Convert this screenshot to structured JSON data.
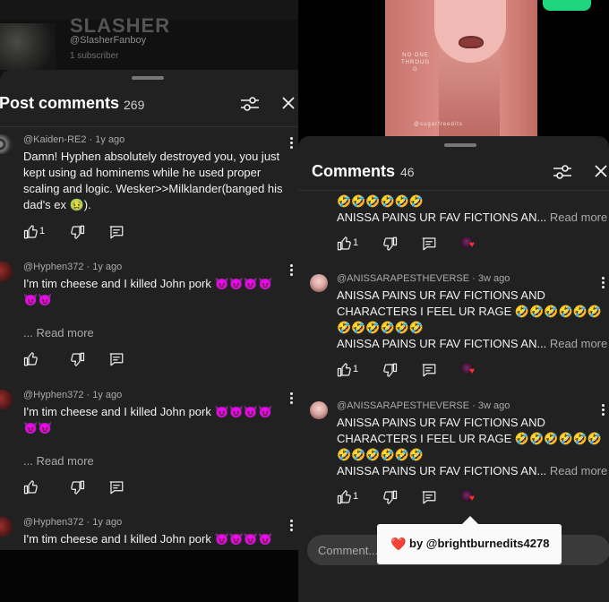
{
  "left": {
    "channel": {
      "name": "SLASHER",
      "handle": "@SlasherFanboy",
      "subscribers": "1 subscriber"
    },
    "sheet": {
      "title": "Post comments",
      "count": "269"
    },
    "comments": [
      {
        "author": "@Kaiden-RE2",
        "time": "1y ago",
        "text_lines": [
          "Damn! Hyphen absolutely destroyed you, you just",
          "kept using ad hominems while he used proper",
          "scaling and logic. Wesker>>Milklander(banged his",
          "dad's ex 🤢)."
        ],
        "likes": "1"
      },
      {
        "author": "@Hyphen372",
        "time": "1y ago",
        "text_lines": [
          "I'm tim cheese and I killed John pork 😈😈😈😈",
          "😈😈"
        ],
        "read_more": "... Read more"
      },
      {
        "author": "@Hyphen372",
        "time": "1y ago",
        "text_lines": [
          "I'm tim cheese and I killed John pork 😈😈😈😈",
          "😈😈"
        ],
        "read_more": "... Read more"
      },
      {
        "author": "@Hyphen372",
        "time": "1y ago",
        "text_lines": [
          "I'm tim cheese and I killed John pork 😈😈😈😈"
        ]
      }
    ]
  },
  "right": {
    "video": {
      "watermark_top": "NO ONE\nTHROUG\nG",
      "watermark_bottom": "@sugarfreedits"
    },
    "sheet": {
      "title": "Comments",
      "count": "46"
    },
    "partial_comment": {
      "emoji_line": "🤣🤣🤣🤣🤣🤣",
      "truncated": "ANISSA PAINS UR FAV FICTIONS AN...",
      "read_more": "Read more",
      "likes": "1"
    },
    "comments": [
      {
        "author": "@ANISSARAPESTHEVERSE",
        "time": "3w ago",
        "text_lines": [
          "ANISSA PAINS UR FAV FICTIONS AND",
          "CHARACTERS I FEEL UR RAGE 🤣🤣🤣🤣🤣🤣",
          "🤣🤣🤣🤣🤣🤣"
        ],
        "truncated": "ANISSA PAINS UR FAV FICTIONS AN...",
        "read_more": "Read more",
        "likes": "1"
      },
      {
        "author": "@ANISSARAPESTHEVERSE",
        "time": "3w ago",
        "text_lines": [
          "ANISSA PAINS UR FAV FICTIONS AND",
          "CHARACTERS I FEEL UR RAGE 🤣🤣🤣🤣🤣🤣",
          "🤣🤣🤣🤣🤣🤣"
        ],
        "truncated": "ANISSA PAINS UR FAV FICTIONS AN...",
        "read_more": "Read more",
        "likes": "1"
      }
    ],
    "composer_placeholder": "Comment...",
    "tooltip": {
      "heart": "❤️",
      "text": "by @brightburnedits4278"
    }
  },
  "icons": {
    "filter": "sliders-icon",
    "close": "close-icon",
    "like": "thumbs-up-icon",
    "dislike": "thumbs-down-icon",
    "reply": "reply-icon",
    "more": "kebab-menu-icon",
    "creator_heart": "creator-heart-icon"
  },
  "colors": {
    "sheet_bg": "#212121",
    "text_primary": "#f1f1f1",
    "text_secondary": "#aaaaaa",
    "accent_green": "#1fd67e",
    "heart_red": "#e5312f"
  }
}
